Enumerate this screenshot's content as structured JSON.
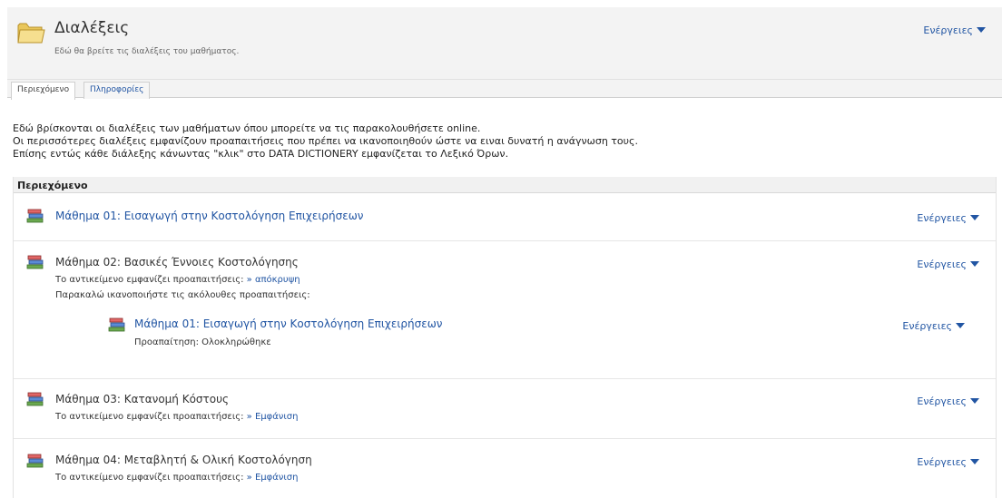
{
  "header": {
    "title": "Διαλέξεις",
    "subtitle": "Εδώ θα βρείτε τις διαλέξεις του μαθήματος.",
    "actions_label": "Ενέργειες"
  },
  "tabs": [
    {
      "label": "Περιεχόμενο",
      "active": true
    },
    {
      "label": "Πληροφορίες",
      "active": false
    }
  ],
  "intro": {
    "line1": "Εδώ βρίσκονται οι διαλέξεις των μαθήματων όπου μπορείτε να τις παρακολουθήσετε online.",
    "line2": "Οι περισσότερες διαλέξεις εμφανίζουν προαπαιτήσεις που πρέπει να ικανοποιηθούν ώστε να ειναι δυνατή η ανάγνωση τους.",
    "line3": "Επίσης εντώς κάθε διάλεξης κάνωντας \"κλικ\" στο DATA DICTIONERY εμφανίζεται το Λεξικό Όρων."
  },
  "content": {
    "header": "Περιεχόμενο",
    "items": [
      {
        "title": "Μάθημα 01: Εισαγωγή στην Κοστολόγηση Επιχειρήσεων",
        "actions_label": "Ενέργειες"
      },
      {
        "title": "Μάθημα 02: Βασικές Έννοιες Κοστολόγησης",
        "actions_label": "Ενέργειες",
        "prereq_text": "Το αντικείμενο εμφανίζει προαπαιτήσεις:",
        "prereq_link": "» απόκρυψη",
        "satisfy_text": "Παρακαλώ ικανοποιήστε τις ακόλουθες προαπαιτήσεις:",
        "sub_item": {
          "title": "Μάθημα 01: Εισαγωγή στην Κοστολόγηση Επιχειρήσεων",
          "status": "Προαπαίτηση: Ολοκληρώθηκε",
          "actions_label": "Ενέργειες"
        }
      },
      {
        "title": "Μάθημα 03: Κατανομή Κόστους",
        "actions_label": "Ενέργειες",
        "prereq_text": "Το αντικείμενο εμφανίζει προαπαιτήσεις:",
        "prereq_link": "» Εμφάνιση"
      },
      {
        "title": "Μάθημα 04: Μεταβλητή & Ολική Κοστολόγηση",
        "actions_label": "Ενέργειες",
        "prereq_text": "Το αντικείμενο εμφανίζει προαπαιτήσεις:",
        "prereq_link": "» Εμφάνιση"
      }
    ]
  }
}
